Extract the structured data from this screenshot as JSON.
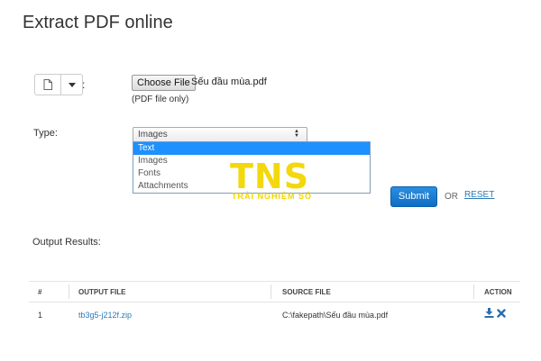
{
  "page": {
    "title": "Extract PDF online"
  },
  "source": {
    "colon": ":"
  },
  "file": {
    "choose_label": "Choose File",
    "file_name": "Sếu đầu mùa.pdf",
    "hint": "(PDF file only)"
  },
  "type": {
    "label": "Type:",
    "selected": "Images",
    "options": [
      "Text",
      "Images",
      "Fonts",
      "Attachments"
    ],
    "highlighted": "Text"
  },
  "watermark": {
    "logo": "TNS",
    "tagline": "TRẢI NGHIỆM SỐ"
  },
  "actions": {
    "submit": "Submit",
    "or": "OR",
    "reset": "RESET"
  },
  "output": {
    "title": "Output Results:",
    "headers": [
      "#",
      "OUTPUT FILE",
      "SOURCE FILE",
      "ACTION"
    ],
    "rows": [
      {
        "num": "1",
        "output_file": "tb3g5-j212f.zip",
        "source_file": "C:\\fakepath\\Sếu đầu mùa.pdf"
      }
    ]
  },
  "colors": {
    "accent": "#1e90ff",
    "link": "#2a7ab8",
    "watermark": "#f2d600"
  }
}
